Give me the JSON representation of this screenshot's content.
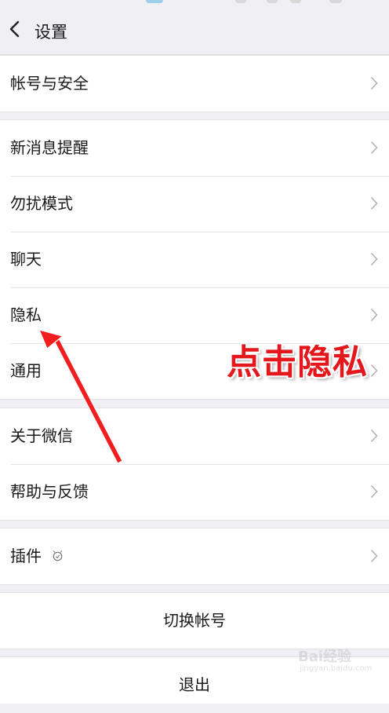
{
  "header": {
    "title": "设置"
  },
  "groups": {
    "g1": [
      {
        "label": "帐号与安全"
      }
    ],
    "g2": [
      {
        "label": "新消息提醒"
      },
      {
        "label": "勿扰模式"
      },
      {
        "label": "聊天"
      },
      {
        "label": "隐私"
      },
      {
        "label": "通用"
      }
    ],
    "g3": [
      {
        "label": "关于微信"
      },
      {
        "label": "帮助与反馈"
      }
    ],
    "g4": [
      {
        "label": "插件"
      }
    ]
  },
  "actions": {
    "switch_account": "切换帐号",
    "logout": "退出"
  },
  "annotation": {
    "text": "点击隐私",
    "color": "#e4171c"
  },
  "watermark": {
    "brand": "Bai",
    "brand_suffix": "经验",
    "site": "jingyan.baidu.com"
  },
  "colors": {
    "background": "#efeff4",
    "row": "#ffffff",
    "chevron": "#b2b2b2"
  },
  "icons": {
    "back": "chevron-left-icon",
    "row": "chevron-right-icon",
    "plugin_badge": "plugin-badge-icon"
  }
}
